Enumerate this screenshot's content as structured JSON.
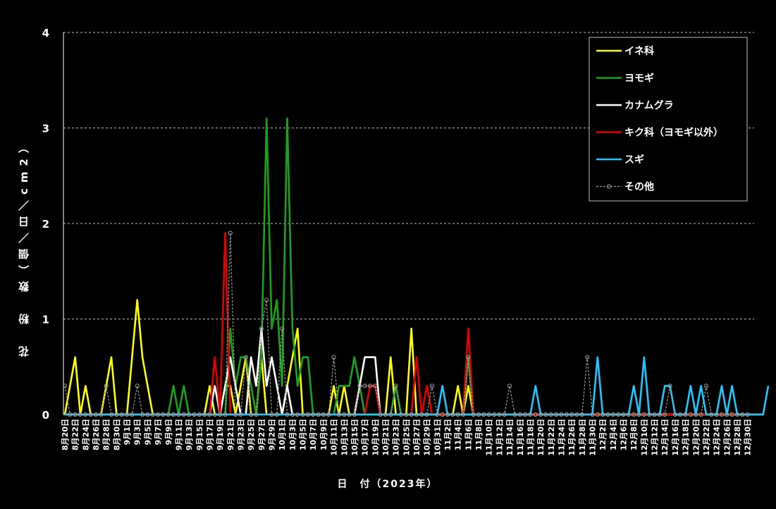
{
  "chart_data": {
    "type": "line",
    "title": "",
    "xlabel": "日　付（2023年）",
    "ylabel": "花　粉　数（個／日／cm2）",
    "ylim": [
      0,
      4
    ],
    "yticks": [
      "0",
      "1",
      "2",
      "3",
      "4"
    ],
    "grid": "horizontal dashed",
    "legend_position": "top-right",
    "x_label_step": 2,
    "categories": [
      "8月20日",
      "8月21日",
      "8月22日",
      "8月23日",
      "8月24日",
      "8月25日",
      "8月26日",
      "8月27日",
      "8月28日",
      "8月29日",
      "8月30日",
      "8月31日",
      "9月1日",
      "9月2日",
      "9月3日",
      "9月4日",
      "9月5日",
      "9月6日",
      "9月7日",
      "9月8日",
      "9月9日",
      "9月10日",
      "9月11日",
      "9月12日",
      "9月13日",
      "9月14日",
      "9月15日",
      "9月16日",
      "9月17日",
      "9月18日",
      "9月19日",
      "9月20日",
      "9月21日",
      "9月22日",
      "9月23日",
      "9月24日",
      "9月25日",
      "9月26日",
      "9月27日",
      "9月28日",
      "9月29日",
      "9月30日",
      "10月1日",
      "10月2日",
      "10月3日",
      "10月4日",
      "10月5日",
      "10月6日",
      "10月7日",
      "10月8日",
      "10月9日",
      "10月10日",
      "10月11日",
      "10月12日",
      "10月13日",
      "10月14日",
      "10月15日",
      "10月16日",
      "10月17日",
      "10月18日",
      "10月19日",
      "10月20日",
      "10月21日",
      "10月22日",
      "10月23日",
      "10月24日",
      "10月25日",
      "10月26日",
      "10月27日",
      "10月28日",
      "10月29日",
      "10月30日",
      "10月31日",
      "11月1日",
      "11月2日",
      "11月3日",
      "11月4日",
      "11月5日",
      "11月6日",
      "11月7日",
      "11月8日",
      "11月9日",
      "11月10日",
      "11月11日",
      "11月12日",
      "11月13日",
      "11月14日",
      "11月15日",
      "11月16日",
      "11月17日",
      "11月18日",
      "11月19日",
      "11月20日",
      "11月21日",
      "11月22日",
      "11月23日",
      "11月24日",
      "11月25日",
      "11月26日",
      "11月27日",
      "11月28日",
      "11月29日",
      "11月30日",
      "12月1日",
      "12月2日",
      "12月3日",
      "12月4日",
      "12月5日",
      "12月6日",
      "12月7日",
      "12月8日",
      "12月9日",
      "12月10日",
      "12月11日",
      "12月12日",
      "12月13日",
      "12月14日",
      "12月15日",
      "12月16日",
      "12月17日",
      "12月18日",
      "12月19日",
      "12月20日",
      "12月21日",
      "12月22日",
      "12月23日",
      "12月24日",
      "12月25日",
      "12月26日",
      "12月27日",
      "12月28日",
      "12月29日",
      "12月30日",
      "12月31日"
    ],
    "series": [
      {
        "name": "イネ科",
        "color": "#ffff00",
        "dashed": false,
        "marker": false,
        "values": [
          0,
          0.3,
          0.6,
          0,
          0.3,
          0,
          0,
          0,
          0.3,
          0.6,
          0,
          0,
          0,
          0.6,
          1.2,
          0.6,
          0.3,
          0,
          0,
          0,
          0,
          0,
          0,
          0,
          0,
          0,
          0,
          0,
          0.3,
          0,
          0,
          0.3,
          0.3,
          0,
          0.3,
          0.6,
          0,
          0,
          0.6,
          0,
          0,
          0,
          0,
          0.3,
          0.6,
          0.9,
          0,
          0,
          0,
          0,
          0,
          0,
          0.3,
          0,
          0.3,
          0,
          0,
          0,
          0,
          0,
          0,
          0,
          0,
          0.6,
          0,
          0,
          0,
          0.9,
          0,
          0,
          0,
          0,
          0,
          0,
          0,
          0,
          0.3,
          0,
          0.3,
          0,
          0,
          0,
          0,
          0,
          0,
          0,
          0,
          0,
          0,
          0,
          0,
          0,
          0,
          0,
          0,
          0,
          0,
          0,
          0,
          0,
          0,
          0,
          0,
          0,
          0,
          0,
          0,
          0,
          0,
          0,
          0,
          0,
          0,
          0,
          0,
          0,
          0,
          0,
          0,
          0,
          0,
          0,
          0,
          0,
          0,
          0,
          0,
          0,
          0,
          0,
          0,
          0,
          0,
          0,
          0
        ]
      },
      {
        "name": "ヨモギ",
        "color": "#1aa31a",
        "dashed": false,
        "marker": false,
        "values": [
          0,
          0,
          0,
          0,
          0,
          0,
          0,
          0,
          0,
          0,
          0,
          0,
          0,
          0,
          0,
          0,
          0,
          0,
          0,
          0,
          0,
          0.3,
          0,
          0.3,
          0,
          0,
          0,
          0,
          0,
          0,
          0,
          0,
          0.9,
          0.3,
          0.6,
          0.6,
          0.3,
          0,
          0.6,
          3.1,
          0.9,
          1.2,
          0.3,
          3.1,
          0.9,
          0.3,
          0.6,
          0.6,
          0,
          0,
          0,
          0,
          0,
          0.3,
          0.3,
          0.3,
          0.6,
          0.3,
          0,
          0,
          0,
          0,
          0,
          0,
          0.3,
          0,
          0,
          0,
          0,
          0,
          0,
          0,
          0,
          0,
          0,
          0,
          0,
          0,
          0.6,
          0,
          0,
          0,
          0,
          0,
          0,
          0,
          0,
          0,
          0,
          0,
          0,
          0,
          0,
          0,
          0,
          0,
          0,
          0,
          0,
          0,
          0,
          0,
          0,
          0,
          0,
          0,
          0,
          0,
          0,
          0,
          0,
          0,
          0,
          0,
          0,
          0,
          0,
          0,
          0,
          0,
          0,
          0,
          0,
          0,
          0,
          0,
          0,
          0,
          0,
          0,
          0,
          0,
          0,
          0,
          0,
          0
        ]
      },
      {
        "name": "カナムグラ",
        "color": "#ffffff",
        "dashed": false,
        "marker": false,
        "values": [
          0,
          0,
          0,
          0,
          0,
          0,
          0,
          0,
          0,
          0,
          0,
          0,
          0,
          0,
          0,
          0,
          0,
          0,
          0,
          0,
          0,
          0,
          0,
          0,
          0,
          0,
          0,
          0,
          0,
          0.3,
          0,
          0.3,
          0.6,
          0.3,
          0,
          0,
          0.6,
          0.3,
          0.9,
          0.3,
          0.6,
          0.3,
          0,
          0.3,
          0,
          0,
          0,
          0,
          0,
          0,
          0,
          0,
          0,
          0,
          0,
          0,
          0,
          0.3,
          0.6,
          0.6,
          0.6,
          0,
          0,
          0,
          0,
          0,
          0,
          0,
          0,
          0,
          0,
          0,
          0,
          0,
          0,
          0,
          0,
          0,
          0,
          0,
          0,
          0,
          0,
          0,
          0,
          0,
          0,
          0,
          0,
          0,
          0,
          0,
          0,
          0,
          0,
          0,
          0,
          0,
          0,
          0,
          0,
          0,
          0,
          0,
          0,
          0,
          0,
          0,
          0,
          0,
          0,
          0,
          0,
          0,
          0,
          0,
          0,
          0,
          0,
          0,
          0,
          0,
          0,
          0,
          0,
          0,
          0,
          0,
          0,
          0,
          0,
          0,
          0,
          0,
          0,
          0
        ]
      },
      {
        "name": "キク科（ヨモギ以外）",
        "color": "#e00000",
        "dashed": false,
        "marker": false,
        "values": [
          0,
          0,
          0,
          0,
          0,
          0,
          0,
          0,
          0,
          0,
          0,
          0,
          0,
          0,
          0,
          0,
          0,
          0,
          0,
          0,
          0,
          0,
          0,
          0,
          0,
          0,
          0,
          0,
          0,
          0.6,
          0,
          1.9,
          0,
          0,
          0,
          0,
          0,
          0,
          0,
          0,
          0,
          0,
          0,
          0,
          0,
          0,
          0,
          0,
          0,
          0,
          0,
          0,
          0,
          0,
          0,
          0,
          0,
          0,
          0,
          0.3,
          0.3,
          0,
          0,
          0,
          0,
          0,
          0,
          0,
          0.6,
          0,
          0.3,
          0,
          0,
          0,
          0,
          0,
          0,
          0,
          0.9,
          0,
          0,
          0,
          0,
          0,
          0,
          0,
          0,
          0,
          0,
          0,
          0,
          0,
          0,
          0,
          0,
          0,
          0,
          0,
          0,
          0,
          0,
          0,
          0,
          0,
          0,
          0,
          0,
          0,
          0,
          0,
          0,
          0,
          0,
          0,
          0,
          0,
          0,
          0,
          0,
          0,
          0,
          0,
          0,
          0,
          0,
          0,
          0,
          0,
          0,
          0,
          0,
          0,
          0,
          0,
          0,
          0
        ]
      },
      {
        "name": "スギ",
        "color": "#1ec8ff",
        "dashed": false,
        "marker": false,
        "values": [
          0,
          0,
          0,
          0,
          0,
          0,
          0,
          0,
          0,
          0,
          0,
          0,
          0,
          0,
          0,
          0,
          0,
          0,
          0,
          0,
          0,
          0,
          0,
          0,
          0,
          0,
          0,
          0,
          0,
          0,
          0,
          0,
          0,
          0,
          0,
          0,
          0,
          0,
          0,
          0,
          0,
          0,
          0,
          0,
          0,
          0,
          0,
          0,
          0,
          0,
          0,
          0,
          0,
          0,
          0,
          0,
          0,
          0,
          0,
          0,
          0,
          0,
          0,
          0,
          0,
          0,
          0,
          0,
          0,
          0,
          0,
          0,
          0,
          0.3,
          0,
          0,
          0,
          0,
          0,
          0,
          0,
          0,
          0,
          0,
          0,
          0,
          0,
          0,
          0,
          0,
          0,
          0.3,
          0,
          0,
          0,
          0,
          0,
          0,
          0,
          0,
          0,
          0,
          0,
          0.6,
          0,
          0,
          0,
          0,
          0,
          0,
          0.3,
          0,
          0.6,
          0,
          0,
          0,
          0.3,
          0.3,
          0,
          0,
          0,
          0.3,
          0,
          0.3,
          0,
          0,
          0,
          0.3,
          0,
          0.3,
          0,
          0,
          0,
          0,
          0,
          0,
          0.3
        ]
      },
      {
        "name": "その他",
        "color": "#9a9a9a",
        "dashed": true,
        "marker": true,
        "values": [
          0.3,
          0,
          0,
          0,
          0,
          0,
          0,
          0,
          0.3,
          0,
          0,
          0,
          0,
          0,
          0.3,
          0,
          0,
          0,
          0,
          0,
          0,
          0,
          0,
          0,
          0,
          0,
          0,
          0,
          0,
          0,
          0,
          0,
          1.9,
          0,
          0,
          0.6,
          0,
          0,
          0.9,
          1.2,
          0,
          0,
          0.9,
          0,
          0,
          0,
          0,
          0,
          0,
          0,
          0,
          0,
          0.6,
          0,
          0,
          0,
          0,
          0.3,
          0.3,
          0.3,
          0.3,
          0,
          0,
          0,
          0.3,
          0,
          0,
          0,
          0,
          0,
          0,
          0.3,
          0,
          0,
          0,
          0,
          0,
          0,
          0.6,
          0,
          0,
          0,
          0,
          0,
          0,
          0,
          0.3,
          0,
          0,
          0,
          0,
          0,
          0,
          0,
          0,
          0,
          0,
          0,
          0,
          0,
          0,
          0.6,
          0,
          0,
          0,
          0,
          0,
          0,
          0,
          0,
          0,
          0,
          0,
          0,
          0,
          0,
          0,
          0.3,
          0,
          0,
          0,
          0,
          0,
          0,
          0.3,
          0,
          0,
          0,
          0,
          0,
          0,
          0,
          0
        ]
      }
    ]
  }
}
